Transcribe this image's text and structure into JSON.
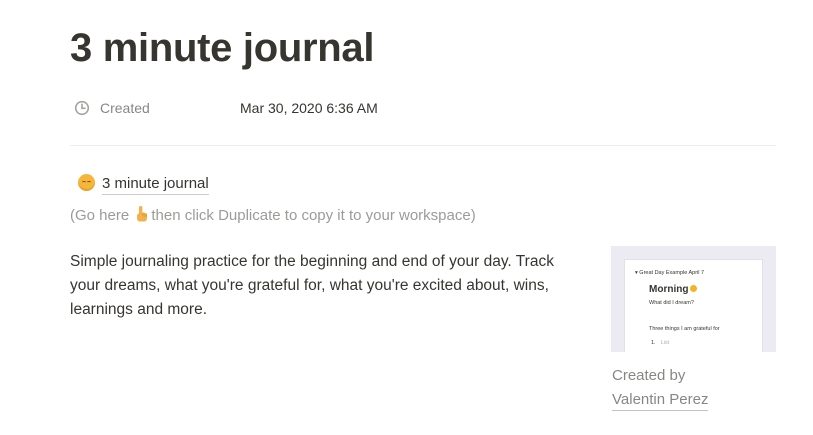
{
  "page": {
    "title": "3 minute journal"
  },
  "properties": [
    {
      "icon": "clock-icon",
      "name": "Created",
      "value": "Mar 30, 2020 6:36 AM"
    }
  ],
  "content": {
    "link": {
      "icon": "smiling-face-emoji-icon",
      "label": "3 minute journal"
    },
    "note": {
      "before": "(Go here ",
      "icon": "pointing-up-hand-icon",
      "after": "then click Duplicate to copy it to your workspace)"
    },
    "description": "Simple journaling practice for the beginning and end of your day. Track your dreams, what you're grateful for, what you're excited about, wins, learnings and more."
  },
  "preview": {
    "heading": "Great Day Example April 7",
    "title": "Morning",
    "question1": "What did I dream?",
    "question2": "Three things I am grateful for",
    "list_number": "1.",
    "list_item": "List"
  },
  "attribution": {
    "label": "Created by",
    "author": "Valentin Perez"
  },
  "colors": {
    "text": "#37352f",
    "muted": "#9b9a97",
    "preview_bg": "#ecebf3",
    "sun": "#f5b323"
  }
}
